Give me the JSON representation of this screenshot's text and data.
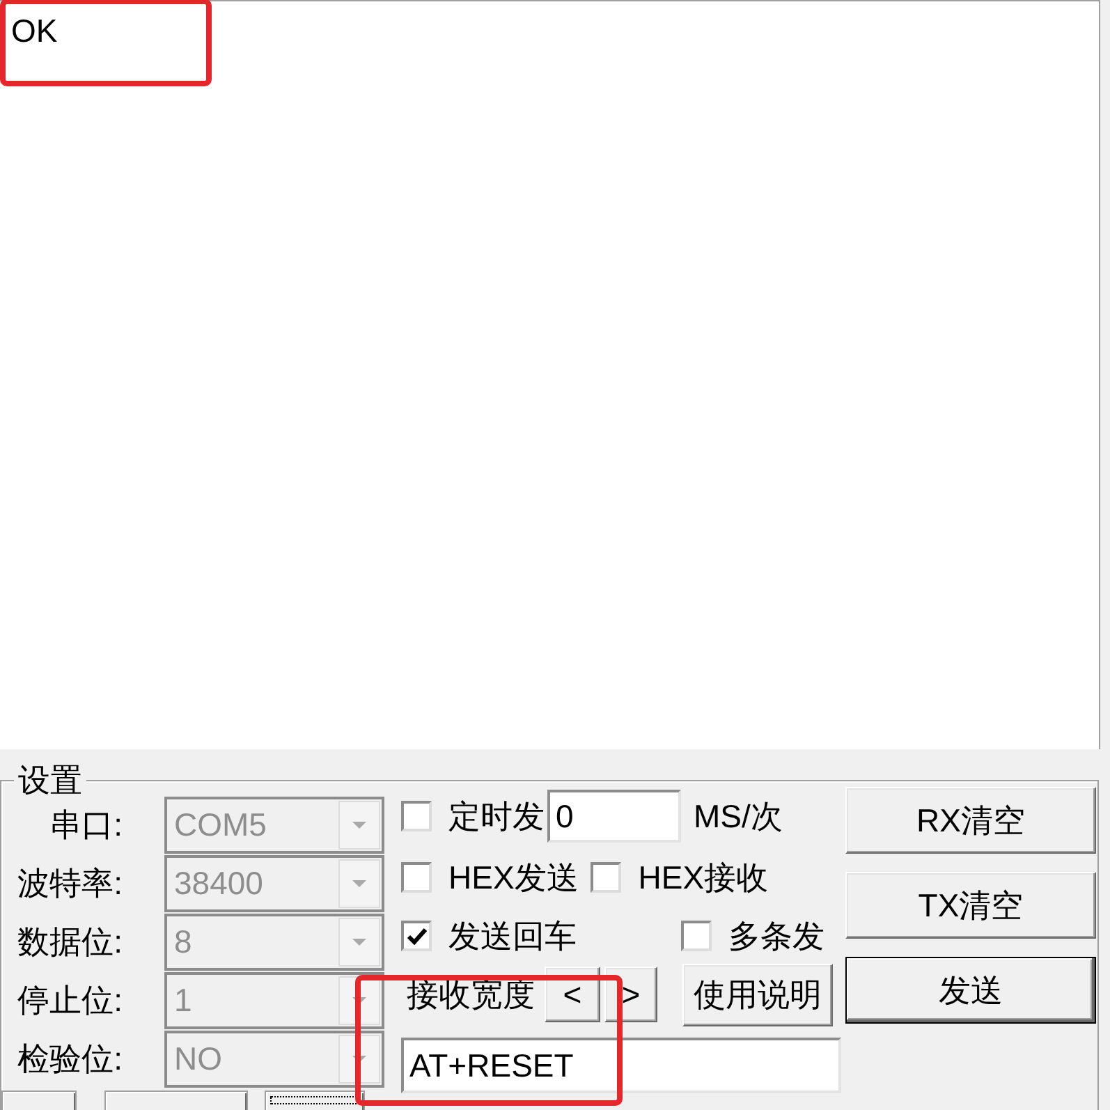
{
  "receive_area": {
    "text": "OK"
  },
  "settings": {
    "title": "设置",
    "port_fields": [
      {
        "label": "串口:",
        "value": "COM5",
        "disabled": true
      },
      {
        "label": "波特率:",
        "value": "38400",
        "disabled": true
      },
      {
        "label": "数据位:",
        "value": "8",
        "disabled": true
      },
      {
        "label": "停止位:",
        "value": "1",
        "disabled": true
      },
      {
        "label": "检验位:",
        "value": "NO",
        "disabled": true
      }
    ],
    "port_buttons": [
      {
        "focused": false
      },
      {
        "focused": false
      },
      {
        "focused": true
      }
    ],
    "timer": {
      "label": "定时发",
      "checked": false,
      "interval": "0",
      "unit": "MS/次"
    },
    "options": [
      [
        {
          "label": "HEX发送",
          "checked": false
        },
        {
          "label": "HEX接收",
          "checked": false
        }
      ],
      [
        {
          "label": "发送回车",
          "checked": true
        },
        {
          "label": "多条发",
          "checked": false
        }
      ]
    ],
    "receive_width": {
      "label": "接收宽度",
      "buttons": [
        "<",
        ">"
      ]
    },
    "help_button": "使用说明",
    "send_field": {
      "value": "AT+RESET"
    },
    "action_buttons": [
      {
        "label": "RX清空",
        "default": false
      },
      {
        "label": "TX清空",
        "default": false
      },
      {
        "label": "发送",
        "default": true
      }
    ]
  }
}
